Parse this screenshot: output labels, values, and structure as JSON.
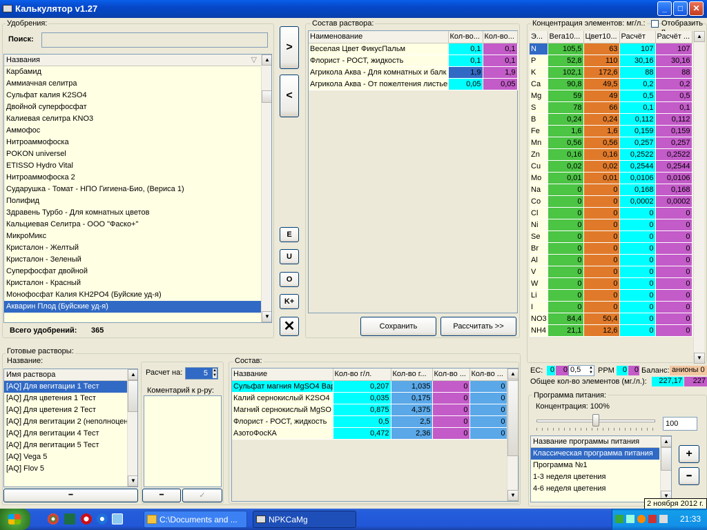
{
  "window": {
    "title": "Калькулятор v1.27"
  },
  "fertilizers": {
    "group_label": "Удобрения:",
    "search_label": "Поиск:",
    "search_value": "",
    "column_header": "Названия",
    "items": [
      "Карбамид",
      "Аммиачная селитра",
      "Сульфат калия K2SO4",
      "Двойной суперфосфат",
      "Калиевая селитра KNO3",
      "Аммофос",
      "Нитроаммофоска",
      "POKON universel",
      "ETISSO Hydro Vital",
      "Нитроаммофоска 2",
      "Сударушка - Томат - НПО Гигиена-Био, (Вериса 1)",
      "Полифид",
      "Здравень Турбо - Для комнатных цветов",
      "Кальциевая Селитра - ООО \"Фаско+\"",
      "МикроМикс",
      "Кристалон - Желтый",
      "Кристалон - Зеленый",
      "Суперфосфат двойной",
      "Кристалон - Красный",
      "Монофосфат Калия KH2PO4 (Буйские уд-я)",
      "Акварин Плод (Буйские уд-я)"
    ],
    "selected_index": 20,
    "total_label": "Всего удобрений:",
    "total_value": "365"
  },
  "move_buttons": {
    "add": ">",
    "remove": "<",
    "e": "E",
    "u": "U",
    "o": "O",
    "k": "K+",
    "x": "✕"
  },
  "solution": {
    "group_label": "Состав раствора:",
    "headers": [
      "Наименование",
      "Кол-во...",
      "Кол-во..."
    ],
    "rows": [
      {
        "name": "Веселая Цвет ФикусПальм",
        "a": "0,1",
        "b": "0,1"
      },
      {
        "name": "Флорист - РОСТ, жидкость",
        "a": "0,1",
        "b": "0,1"
      },
      {
        "name": "Агрикола Аква - Для комнатных и балк",
        "a": "1,9",
        "b": "1,9"
      },
      {
        "name": "Агрикола Аква - От пожелтения листьев",
        "a": "0,05",
        "b": "0,05"
      }
    ],
    "save_button": "Сохранить",
    "calc_button": "Рассчитать >>"
  },
  "concentration": {
    "group_label": "Концентрация элементов: мг/л.:",
    "show_label": "Отобразить п",
    "headers": [
      "Э...",
      "Вега10...",
      "Цвет10...",
      "Расчёт",
      "Расчёт ..."
    ],
    "rows": [
      [
        "N",
        "105,5",
        "63",
        "107",
        "107"
      ],
      [
        "P",
        "52,8",
        "110",
        "30,16",
        "30,16"
      ],
      [
        "K",
        "102,1",
        "172,6",
        "88",
        "88"
      ],
      [
        "Ca",
        "90,8",
        "49,5",
        "0,2",
        "0,2"
      ],
      [
        "Mg",
        "59",
        "49",
        "0,5",
        "0,5"
      ],
      [
        "S",
        "78",
        "66",
        "0,1",
        "0,1"
      ],
      [
        "B",
        "0,24",
        "0,24",
        "0,112",
        "0,112"
      ],
      [
        "Fe",
        "1,6",
        "1,6",
        "0,159",
        "0,159"
      ],
      [
        "Mn",
        "0,56",
        "0,56",
        "0,257",
        "0,257"
      ],
      [
        "Zn",
        "0,16",
        "0,16",
        "0,2522",
        "0,2522"
      ],
      [
        "Cu",
        "0,02",
        "0,02",
        "0,2544",
        "0,2544"
      ],
      [
        "Mo",
        "0,01",
        "0,01",
        "0,0106",
        "0,0106"
      ],
      [
        "Na",
        "0",
        "0",
        "0,168",
        "0,168"
      ],
      [
        "Co",
        "0",
        "0",
        "0,0002",
        "0,0002"
      ],
      [
        "Cl",
        "0",
        "0",
        "0",
        "0"
      ],
      [
        "Ni",
        "0",
        "0",
        "0",
        "0"
      ],
      [
        "Se",
        "0",
        "0",
        "0",
        "0"
      ],
      [
        "Br",
        "0",
        "0",
        "0",
        "0"
      ],
      [
        "Al",
        "0",
        "0",
        "0",
        "0"
      ],
      [
        "V",
        "0",
        "0",
        "0",
        "0"
      ],
      [
        "W",
        "0",
        "0",
        "0",
        "0"
      ],
      [
        "Li",
        "0",
        "0",
        "0",
        "0"
      ],
      [
        "I",
        "0",
        "0",
        "0",
        "0"
      ],
      [
        "NO3",
        "84,4",
        "50,4",
        "0",
        "0"
      ],
      [
        "NH4",
        "21,1",
        "12,6",
        "0",
        "0"
      ]
    ],
    "ec_label": "EC:",
    "ec_a": "0",
    "ec_b": "0",
    "ec_c": "0,5",
    "ppm_label": "PPM",
    "ppm_a": "0",
    "ppm_b": "0",
    "balance_label": "Баланс:",
    "balance_value": "анионы 0",
    "total_label": "Общее кол-во элементов (мг./л.):",
    "total_a": "227,17",
    "total_b": "227"
  },
  "ready": {
    "group_label": "Готовые растворы:",
    "name_label": "Название:",
    "column_header": "Имя раствора",
    "items": [
      "[AQ] Для вегитации 1 Тест",
      "[AQ] Для цветения 1 Тест",
      "[AQ] Для цветения 2 Тест",
      "[AQ] Для вегитации 2 (неполноцен",
      "[AQ] Для вегитации 4 Тест",
      "[AQ] Для вегитации 5 Тест",
      "[AQ] Vega 5",
      "[AQ] Flov 5"
    ],
    "selected_index": 0,
    "minus": "━",
    "calc_label": "Расчет на:",
    "calc_value": "5",
    "comment_label": "Коментарий к р-ру:",
    "comment_minus": "━",
    "comment_check": "✓"
  },
  "composition": {
    "group_label": "Состав:",
    "headers": [
      "Название",
      "Кол-во г/л.",
      "Кол-во г...",
      "Кол-во ...",
      "Кол-во ..."
    ],
    "rows": [
      [
        "Сульфат магния MgSO4 Вар",
        "0,207",
        "1,035",
        "0",
        "0"
      ],
      [
        "Калий сернокислый K2SO4",
        "0,035",
        "0,175",
        "0",
        "0"
      ],
      [
        "Магний сернокислый MgSO",
        "0,875",
        "4,375",
        "0",
        "0"
      ],
      [
        "Флорист - РОСТ, жидкость",
        "0,5",
        "2,5",
        "0",
        "0"
      ],
      [
        "АзотоФосКА",
        "0,472",
        "2,36",
        "0",
        "0"
      ]
    ]
  },
  "program": {
    "group_label": "Программа питания:",
    "conc_label": "Концентрация: 100%",
    "slider_percent": 100,
    "conc_value": "100",
    "column_header": "Название программы питания",
    "items": [
      "Классическая программа питания",
      "Программа №1",
      "1-3 неделя цветения",
      "4-6 неделя цветения"
    ],
    "selected_index": 0,
    "plus": "+",
    "minus": "━",
    "tooltip": "2 ноября 2012 г."
  },
  "taskbar": {
    "task1": "C:\\Documents and ...",
    "task2": "NPKCaMg",
    "clock": "21:33"
  }
}
